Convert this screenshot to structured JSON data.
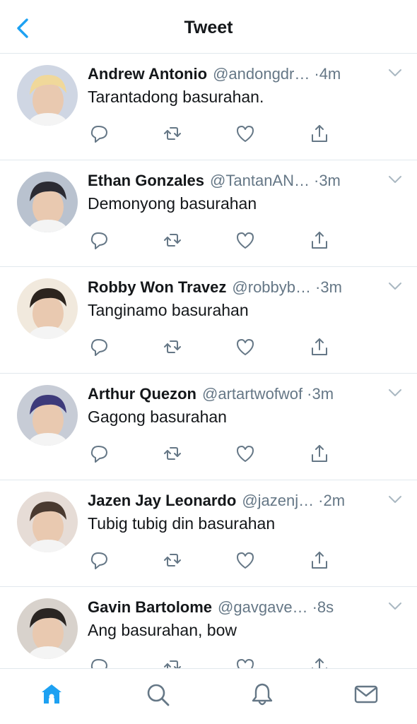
{
  "header": {
    "title": "Tweet"
  },
  "tweets": [
    {
      "name": "Andrew Antonio",
      "handle": "@andongdr…",
      "time": "·4m",
      "text": "Tarantadong basurahan.",
      "avatar_bg": "#cfd6e3",
      "avatar_fg": "#f0d89a"
    },
    {
      "name": "Ethan Gonzales",
      "handle": "@TantanAN…",
      "time": "·3m",
      "text": "Demonyong basurahan",
      "avatar_bg": "#b9c2cf",
      "avatar_fg": "#2b2b33"
    },
    {
      "name": "Robby Won Travez",
      "handle": "@robbyb…",
      "time": "·3m",
      "text": "Tanginamo basurahan",
      "avatar_bg": "#f1e9dd",
      "avatar_fg": "#2c241e"
    },
    {
      "name": "Arthur Quezon",
      "handle": "@artartwofwof",
      "time": "·3m",
      "text": "Gagong basurahan",
      "avatar_bg": "#c7ccd6",
      "avatar_fg": "#3d3a7a"
    },
    {
      "name": "Jazen Jay Leonardo",
      "handle": "@jazenj…",
      "time": "·2m",
      "text": "Tubig tubig din basurahan",
      "avatar_bg": "#e6dcd6",
      "avatar_fg": "#4a3a30"
    },
    {
      "name": "Gavin Bartolome",
      "handle": "@gavgave…",
      "time": "·8s",
      "text": "Ang basurahan, bow",
      "avatar_bg": "#d8d2cc",
      "avatar_fg": "#2a2522"
    }
  ],
  "icons": {
    "back": "chevron-left-icon",
    "reply": "reply-icon",
    "retweet": "retweet-icon",
    "like": "heart-icon",
    "share": "share-icon",
    "more": "chevron-down-icon",
    "tabs": [
      "home-icon",
      "search-icon",
      "bell-icon",
      "mail-icon"
    ]
  },
  "colors": {
    "accent": "#1da1f2",
    "icon_gray": "#657786",
    "divider": "#e1e8ed"
  }
}
